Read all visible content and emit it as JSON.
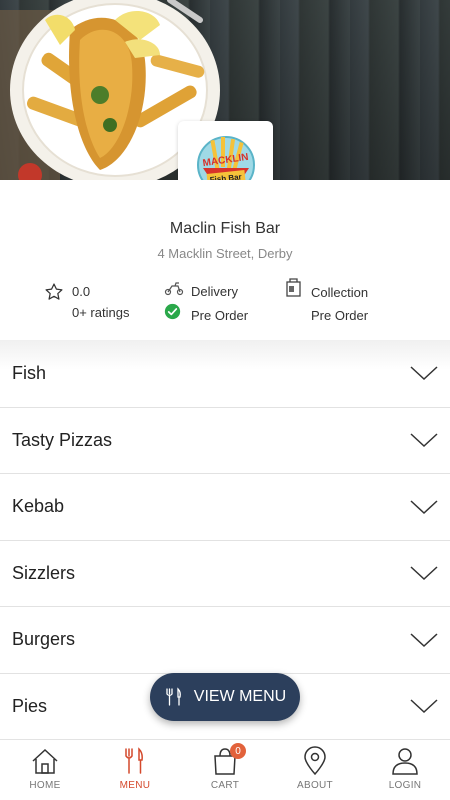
{
  "shop": {
    "name": "Maclin Fish Bar",
    "address": "4 Macklin Street, Derby",
    "logo_text_top": "MACKLIN",
    "logo_text_bottom": "Fish Bar"
  },
  "stats": {
    "rating_value": "0.0",
    "ratings_count": "0+ ratings",
    "delivery_label": "Delivery",
    "delivery_preorder": "Pre Order",
    "collection_label": "Collection",
    "collection_preorder": "Pre Order"
  },
  "categories": [
    {
      "label": "Fish"
    },
    {
      "label": "Tasty Pizzas"
    },
    {
      "label": "Kebab"
    },
    {
      "label": "Sizzlers"
    },
    {
      "label": "Burgers"
    },
    {
      "label": "Pies"
    }
  ],
  "view_menu_label": "VIEW MENU",
  "tabs": [
    {
      "label": "HOME",
      "icon": "home-icon"
    },
    {
      "label": "MENU",
      "icon": "cutlery-icon"
    },
    {
      "label": "CART",
      "icon": "shopping-bag-icon"
    },
    {
      "label": "ABOUT",
      "icon": "location-pin-icon"
    },
    {
      "label": "LOGIN",
      "icon": "user-icon"
    }
  ],
  "cart_count": "0",
  "colors": {
    "accent": "#d4492c",
    "button": "#2c3f5c",
    "badge": "#e2623b",
    "check": "#2aa84a"
  }
}
